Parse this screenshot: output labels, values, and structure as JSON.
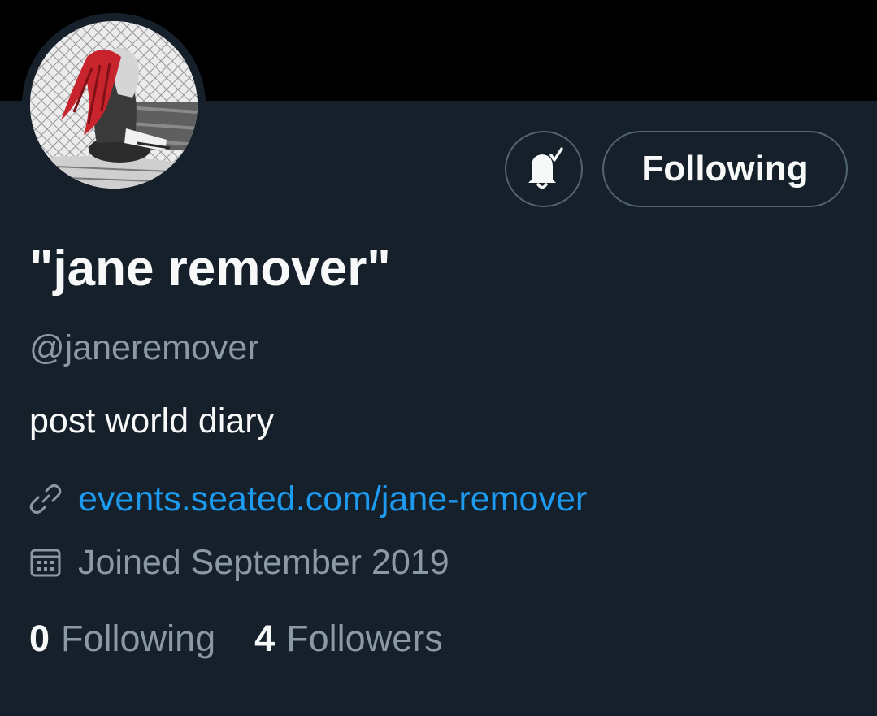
{
  "profile": {
    "display_name": "\"jane remover\"",
    "handle": "@janeremover",
    "bio": "post world diary",
    "website": "events.seated.com/jane-remover",
    "joined": "Joined September 2019"
  },
  "actions": {
    "notifications_icon": "bell-check-icon",
    "follow_label": "Following"
  },
  "stats": {
    "following_count": "0",
    "following_label": "Following",
    "followers_count": "4",
    "followers_label": "Followers"
  },
  "icons": {
    "link": "link-icon",
    "joined": "calendar-icon"
  },
  "colors": {
    "background": "#15202b",
    "banner": "#000000",
    "primary_text": "#f7f9f9",
    "secondary_text": "#8b98a5",
    "link": "#1d9bf0",
    "button_border": "#536471"
  }
}
